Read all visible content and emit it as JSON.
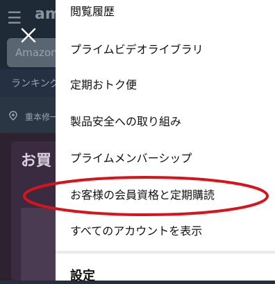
{
  "background": {
    "search_placeholder": "Amazon",
    "nav_text": "ランキング",
    "location_text": "重本修一",
    "card_title": "お買"
  },
  "menu": {
    "items": [
      {
        "label": "閲覧履歴"
      },
      {
        "label": "プライムビデオライブラリ"
      },
      {
        "label": "定期おトク便"
      },
      {
        "label": "製品安全への取り組み"
      },
      {
        "label": "プライムメンバーシップ"
      },
      {
        "label": "お客様の会員資格と定期購読"
      },
      {
        "label": "すべてのアカウントを表示"
      }
    ],
    "section_title": "設定"
  },
  "colors": {
    "annotation": "#d7141a",
    "menu_bg": "#ffffff",
    "overlay_bg": "#232f3e"
  },
  "icons": [
    "close-icon",
    "hamburger-icon",
    "location-pin-icon"
  ]
}
